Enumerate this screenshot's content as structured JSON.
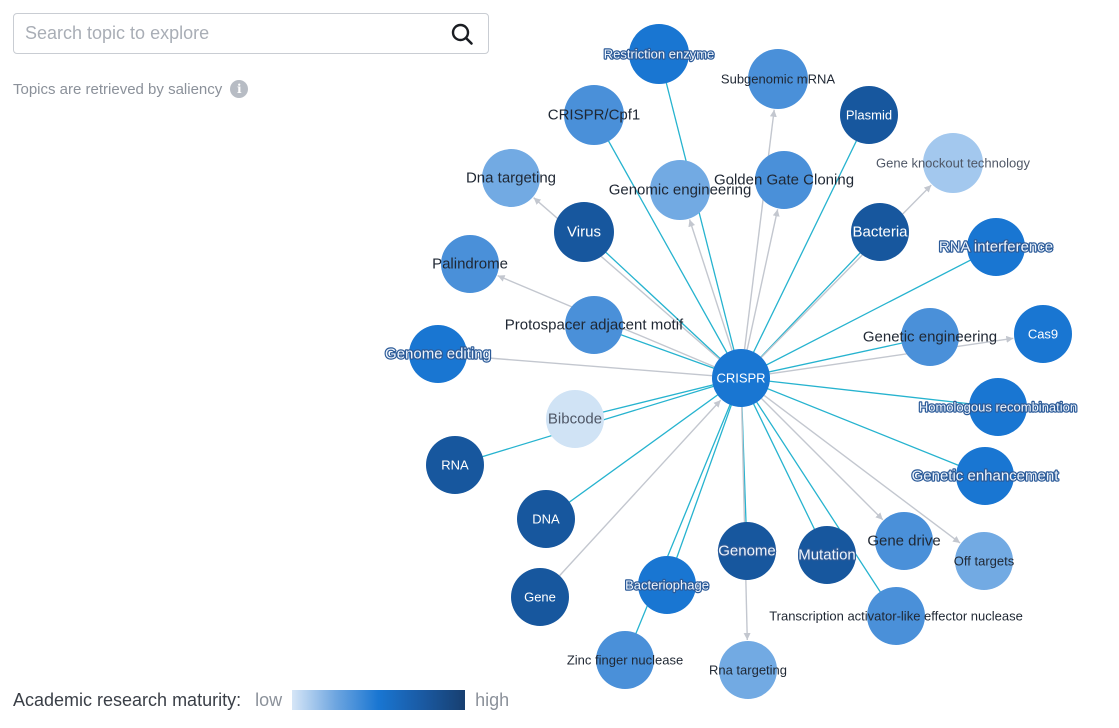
{
  "search": {
    "placeholder": "Search topic to explore",
    "value": "",
    "icon": "search-icon"
  },
  "hint": {
    "text": "Topics are retrieved by saliency",
    "icon": "info-icon",
    "icon_glyph": "i"
  },
  "legend": {
    "label": "Academic research maturity:",
    "low": "low",
    "high": "high",
    "gradient_colors": [
      "#d6e6f7",
      "#6fa6e0",
      "#1976d2",
      "#1a5aa3",
      "#173f70"
    ]
  },
  "graph": {
    "center": "crispr",
    "maturity_scale": {
      "1": "#d0e3f5",
      "2": "#a3c8ee",
      "3": "#72aae3",
      "4": "#4a90d9",
      "5": "#1976d2",
      "6": "#17579e"
    },
    "edge_colors": {
      "related": "#26b3cf",
      "directed": "#c3c7cf"
    },
    "nodes": [
      {
        "id": "crispr",
        "label": "CRISPR",
        "maturity": 5
      },
      {
        "id": "restriction-enzyme",
        "label": "Restriction enzyme",
        "maturity": 5
      },
      {
        "id": "subgenomic-mrna",
        "label": "Subgenomic mRNA",
        "maturity": 4
      },
      {
        "id": "plasmid",
        "label": "Plasmid",
        "maturity": 6
      },
      {
        "id": "crispr-cpf1",
        "label": "CRISPR/Cpf1",
        "maturity": 4
      },
      {
        "id": "gene-knockout-technology",
        "label": "Gene knockout technology",
        "maturity": 2
      },
      {
        "id": "dna-targeting",
        "label": "Dna targeting",
        "maturity": 3
      },
      {
        "id": "genomic-engineering",
        "label": "Genomic engineering",
        "maturity": 3
      },
      {
        "id": "golden-gate-cloning",
        "label": "Golden Gate Cloning",
        "maturity": 4
      },
      {
        "id": "virus",
        "label": "Virus",
        "maturity": 6
      },
      {
        "id": "bacteria",
        "label": "Bacteria",
        "maturity": 6
      },
      {
        "id": "rna-interference",
        "label": "RNA interference",
        "maturity": 5
      },
      {
        "id": "palindrome",
        "label": "Palindrome",
        "maturity": 4
      },
      {
        "id": "protospacer-adjacent-motif",
        "label": "Protospacer adjacent motif",
        "maturity": 4
      },
      {
        "id": "genetic-engineering",
        "label": "Genetic engineering",
        "maturity": 4
      },
      {
        "id": "cas9",
        "label": "Cas9",
        "maturity": 5
      },
      {
        "id": "genome-editing",
        "label": "Genome editing",
        "maturity": 5
      },
      {
        "id": "bibcode",
        "label": "Bibcode",
        "maturity": 1
      },
      {
        "id": "homologous-recombination",
        "label": "Homologous recombination",
        "maturity": 5
      },
      {
        "id": "rna",
        "label": "RNA",
        "maturity": 6
      },
      {
        "id": "genetic-enhancement",
        "label": "Genetic enhancement",
        "maturity": 5
      },
      {
        "id": "dna",
        "label": "DNA",
        "maturity": 6
      },
      {
        "id": "genome",
        "label": "Genome",
        "maturity": 6
      },
      {
        "id": "mutation",
        "label": "Mutation",
        "maturity": 6
      },
      {
        "id": "gene-drive",
        "label": "Gene drive",
        "maturity": 4
      },
      {
        "id": "off-targets",
        "label": "Off targets",
        "maturity": 3
      },
      {
        "id": "gene",
        "label": "Gene",
        "maturity": 6
      },
      {
        "id": "bacteriophage",
        "label": "Bacteriophage",
        "maturity": 5
      },
      {
        "id": "talen",
        "label": "Transcription activator-like effector nuclease",
        "maturity": 4
      },
      {
        "id": "zinc-finger-nuclease",
        "label": "Zinc finger nuclease",
        "maturity": 4
      },
      {
        "id": "rna-targeting",
        "label": "Rna targeting",
        "maturity": 3
      }
    ],
    "edges": [
      {
        "source": "crispr",
        "target": "restriction-enzyme",
        "kind": "related"
      },
      {
        "source": "crispr",
        "target": "crispr-cpf1",
        "kind": "related"
      },
      {
        "source": "crispr",
        "target": "virus",
        "kind": "related"
      },
      {
        "source": "crispr",
        "target": "plasmid",
        "kind": "related"
      },
      {
        "source": "crispr",
        "target": "bacteria",
        "kind": "related"
      },
      {
        "source": "crispr",
        "target": "rna-interference",
        "kind": "related"
      },
      {
        "source": "crispr",
        "target": "genetic-engineering",
        "kind": "related"
      },
      {
        "source": "crispr",
        "target": "protospacer-adjacent-motif",
        "kind": "related"
      },
      {
        "source": "crispr",
        "target": "homologous-recombination",
        "kind": "related"
      },
      {
        "source": "crispr",
        "target": "genetic-enhancement",
        "kind": "related"
      },
      {
        "source": "crispr",
        "target": "bibcode",
        "kind": "related"
      },
      {
        "source": "crispr",
        "target": "rna",
        "kind": "related"
      },
      {
        "source": "crispr",
        "target": "dna",
        "kind": "related"
      },
      {
        "source": "crispr",
        "target": "bacteriophage",
        "kind": "related"
      },
      {
        "source": "crispr",
        "target": "zinc-finger-nuclease",
        "kind": "related"
      },
      {
        "source": "crispr",
        "target": "genome",
        "kind": "related"
      },
      {
        "source": "crispr",
        "target": "mutation",
        "kind": "related"
      },
      {
        "source": "crispr",
        "target": "talen",
        "kind": "related"
      },
      {
        "source": "crispr",
        "target": "subgenomic-mrna",
        "kind": "directed"
      },
      {
        "source": "crispr",
        "target": "genomic-engineering",
        "kind": "directed"
      },
      {
        "source": "crispr",
        "target": "golden-gate-cloning",
        "kind": "directed"
      },
      {
        "source": "crispr",
        "target": "dna-targeting",
        "kind": "directed"
      },
      {
        "source": "crispr",
        "target": "palindrome",
        "kind": "directed"
      },
      {
        "source": "crispr",
        "target": "genome-editing",
        "kind": "directed"
      },
      {
        "source": "crispr",
        "target": "gene-knockout-technology",
        "kind": "directed"
      },
      {
        "source": "crispr",
        "target": "cas9",
        "kind": "directed"
      },
      {
        "source": "gene",
        "target": "crispr",
        "kind": "directed"
      },
      {
        "source": "crispr",
        "target": "gene-drive",
        "kind": "directed"
      },
      {
        "source": "crispr",
        "target": "off-targets",
        "kind": "directed"
      },
      {
        "source": "crispr",
        "target": "rna-targeting",
        "kind": "directed"
      }
    ]
  }
}
